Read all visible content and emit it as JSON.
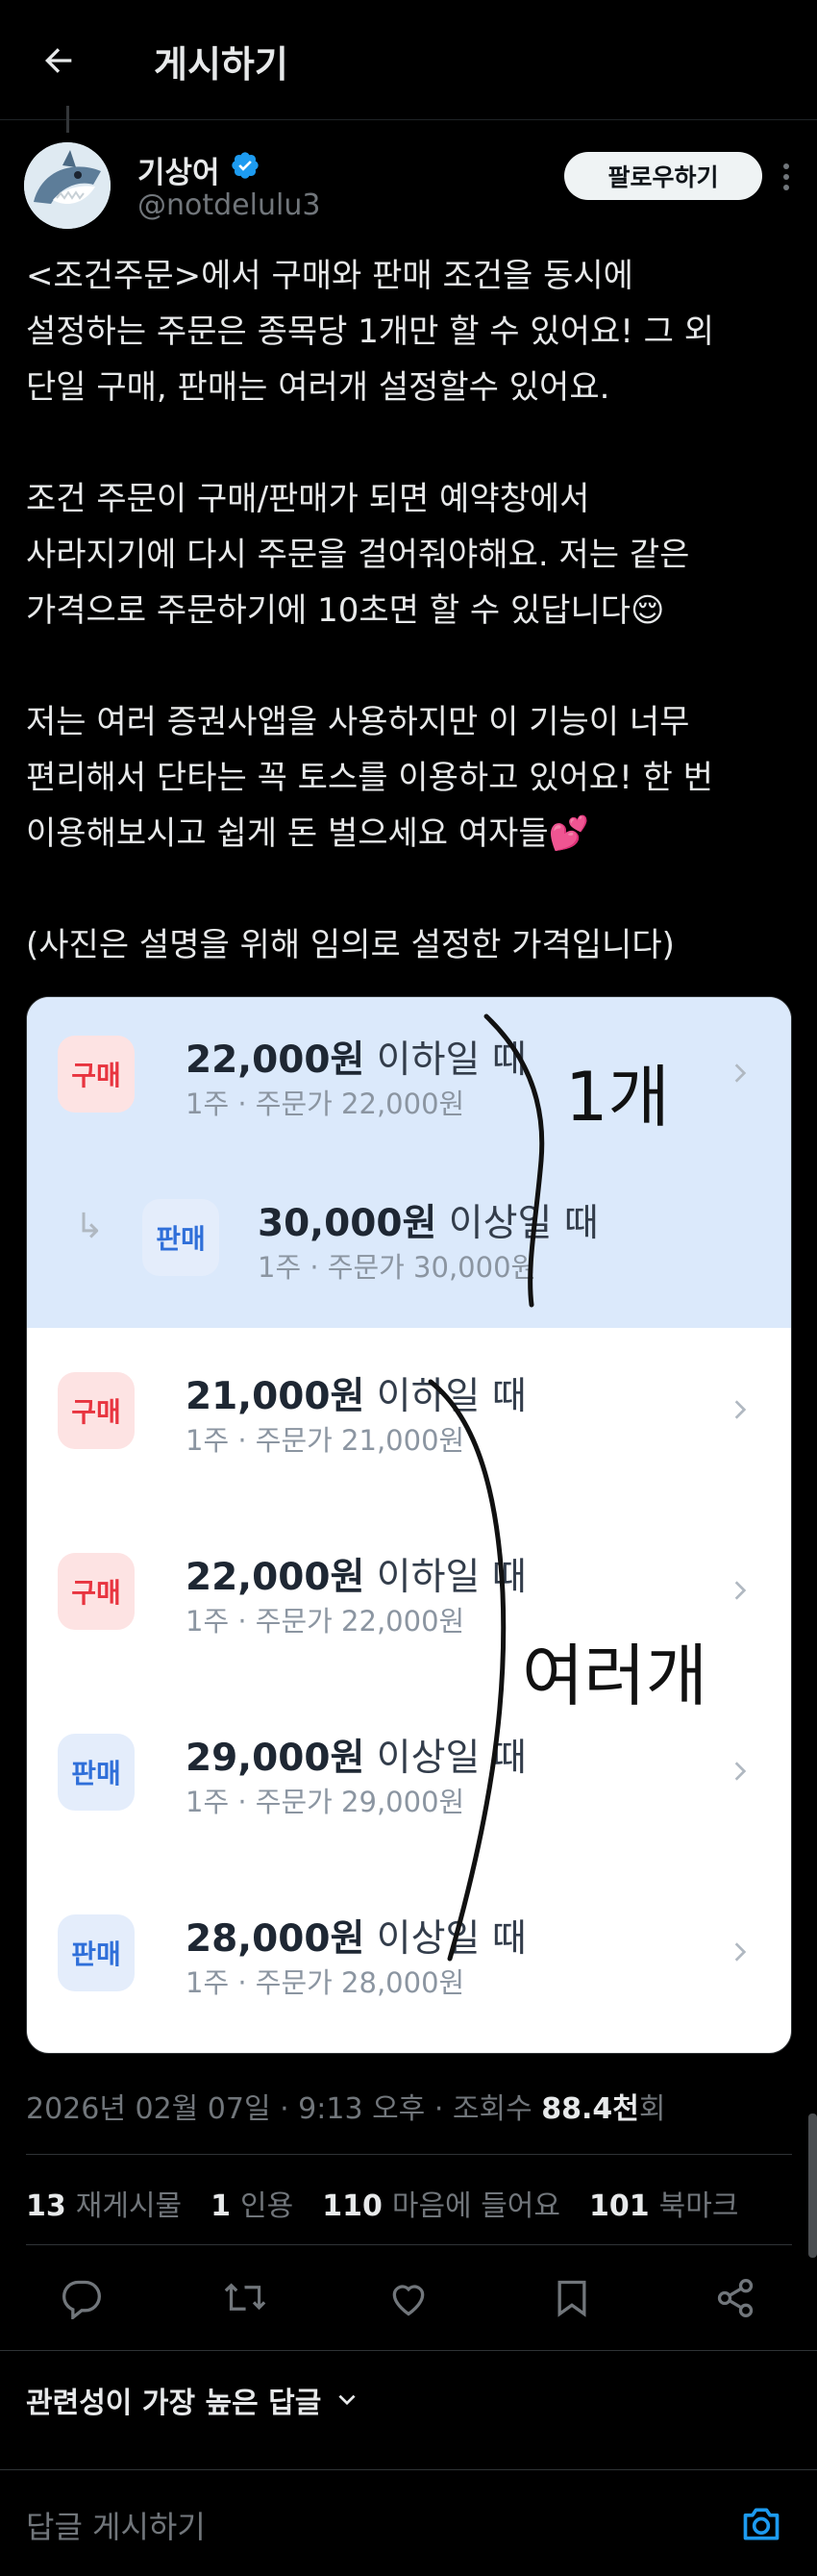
{
  "header": {
    "title": "게시하기",
    "back_icon": "arrow-left-icon"
  },
  "author": {
    "name": "기상어",
    "handle": "@notdelulu3",
    "verified": true,
    "follow_label": "팔로우하기",
    "more_icon": "more-vertical-icon"
  },
  "post": {
    "lines": [
      "<조건주문>에서 구매와 판매 조건을 동시에",
      "설정하는 주문은 종목당 1개만 할 수 있어요! 그 외",
      "단일 구매, 판매는 여러개 설정할수 있어요.",
      "",
      "조건 주문이 구매/판매가 되면 예약창에서",
      "사라지기에 다시 주문을 걸어줘야해요. 저는 같은",
      "가격으로 주문하기에 10초면 할 수 있답니다😌",
      "",
      "저는 여러 증권사앱을 사용하지만 이 기능이 너무",
      "편리해서 단타는 꼭 토스를 이용하고 있어요! 한 번",
      "이용해보시고 쉽게 돈 벌으세요 여자들💕",
      "",
      "(사진은 설명을 위해 임의로 설정한 가격입니다)"
    ]
  },
  "media": {
    "orders": [
      {
        "type": "구매",
        "price": "22,000원",
        "condition": "이하일 때",
        "sub": "1주 · 주문가 22,000원",
        "highlight": true,
        "linked": false
      },
      {
        "type": "판매",
        "price": "30,000원",
        "condition": "이상일 때",
        "sub": "1주 · 주문가 30,000원",
        "highlight": true,
        "linked": true
      },
      {
        "type": "구매",
        "price": "21,000원",
        "condition": "이하일 때",
        "sub": "1주 · 주문가 21,000원",
        "highlight": false,
        "linked": false
      },
      {
        "type": "구매",
        "price": "22,000원",
        "condition": "이하일 때",
        "sub": "1주 · 주문가 22,000원",
        "highlight": false,
        "linked": false
      },
      {
        "type": "판매",
        "price": "29,000원",
        "condition": "이상일 때",
        "sub": "1주 · 주문가 29,000원",
        "highlight": false,
        "linked": false
      },
      {
        "type": "판매",
        "price": "28,000원",
        "condition": "이상일 때",
        "sub": "1주 · 주문가 28,000원",
        "highlight": false,
        "linked": false
      }
    ],
    "handwriting": {
      "note_top": "1개",
      "note_bottom": "여러개"
    },
    "colors": {
      "buy": "#e8343f",
      "sell": "#2f6fd9",
      "highlight_bg": "#dbe9fb"
    }
  },
  "meta": {
    "datetime": "2026년 02월 07일 · 9:13 오후 · ",
    "views_label": "조회수 ",
    "views_value": "88.4천",
    "views_suffix": "회"
  },
  "stats": [
    {
      "count": "13",
      "label": "재게시물"
    },
    {
      "count": "1",
      "label": "인용"
    },
    {
      "count": "110",
      "label": "마음에 들어요"
    },
    {
      "count": "101",
      "label": "북마크"
    }
  ],
  "actions": [
    "reply-icon",
    "repost-icon",
    "like-icon",
    "bookmark-icon",
    "share-icon"
  ],
  "replies": {
    "sort_label": "관련성이 가장 높은 답글",
    "input_placeholder": "답글 게시하기",
    "camera_icon": "camera-icon"
  }
}
